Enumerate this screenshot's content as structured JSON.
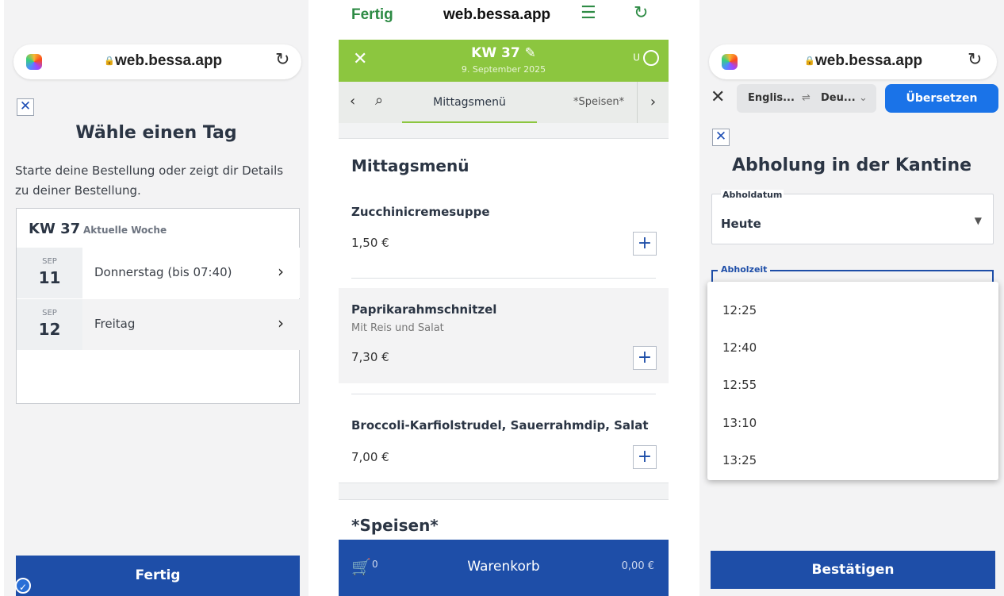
{
  "panel1": {
    "browser": {
      "host": "web.bessa.app"
    },
    "title": "Wähle einen Tag",
    "intro": "Starte deine Bestellung oder zeigt dir Details zu deiner Bestellung.",
    "week": {
      "label": "KW 37",
      "sub": "Aktuelle Woche"
    },
    "days": [
      {
        "month": "SEP",
        "day": "11",
        "label": "Donnerstag (bis 07:40)"
      },
      {
        "month": "SEP",
        "day": "12",
        "label": "Freitag"
      }
    ],
    "done_button": "Fertig"
  },
  "panel2": {
    "safari": {
      "done": "Fertig",
      "host": "web.bessa.app"
    },
    "header": {
      "week": "KW 37",
      "date": "9. September 2025",
      "user": "U"
    },
    "tabs": {
      "active": "Mittagsmenü",
      "next": "*Speisen*"
    },
    "section1": "Mittagsmenü",
    "meals": [
      {
        "name": "Zucchinicremesuppe",
        "desc": "",
        "price": "1,50 €"
      },
      {
        "name": "Paprikarahmschnitzel",
        "desc": "Mit Reis und Salat",
        "price": "7,30 €"
      },
      {
        "name": "Broccoli-Karfiolstrudel, Sauerrahmdip, Salat",
        "desc": "",
        "price": "7,00 €"
      }
    ],
    "section2": "*Speisen*",
    "cart": {
      "count": "0",
      "label": "Warenkorb",
      "total": "0,00 €"
    }
  },
  "panel3": {
    "browser": {
      "host": "web.bessa.app"
    },
    "translate": {
      "from": "Englis...",
      "to": "Deu...",
      "button": "Übersetzen"
    },
    "title": "Abholung in der Kantine",
    "pickup_date": {
      "label": "Abholdatum",
      "value": "Heute"
    },
    "pickup_time": {
      "label": "Abholzeit"
    },
    "times": [
      "12:25",
      "12:40",
      "12:55",
      "13:10",
      "13:25"
    ],
    "confirm_button": "Bestätigen"
  },
  "colors": {
    "brand_blue": "#1e4ea8",
    "header_green": "#8cc63f",
    "safari_green": "#2e8b45",
    "translate_blue": "#1a73e8"
  },
  "icons": [
    "copilot-logo-icon",
    "lock-icon",
    "reload-icon",
    "close-icon",
    "chevron-right-icon",
    "chevron-left-icon",
    "search-icon",
    "pencil-icon",
    "user-icon",
    "plus-icon",
    "cart-icon",
    "swap-icon",
    "dropdown-arrow-icon",
    "reader-icon",
    "check-badge-icon"
  ]
}
